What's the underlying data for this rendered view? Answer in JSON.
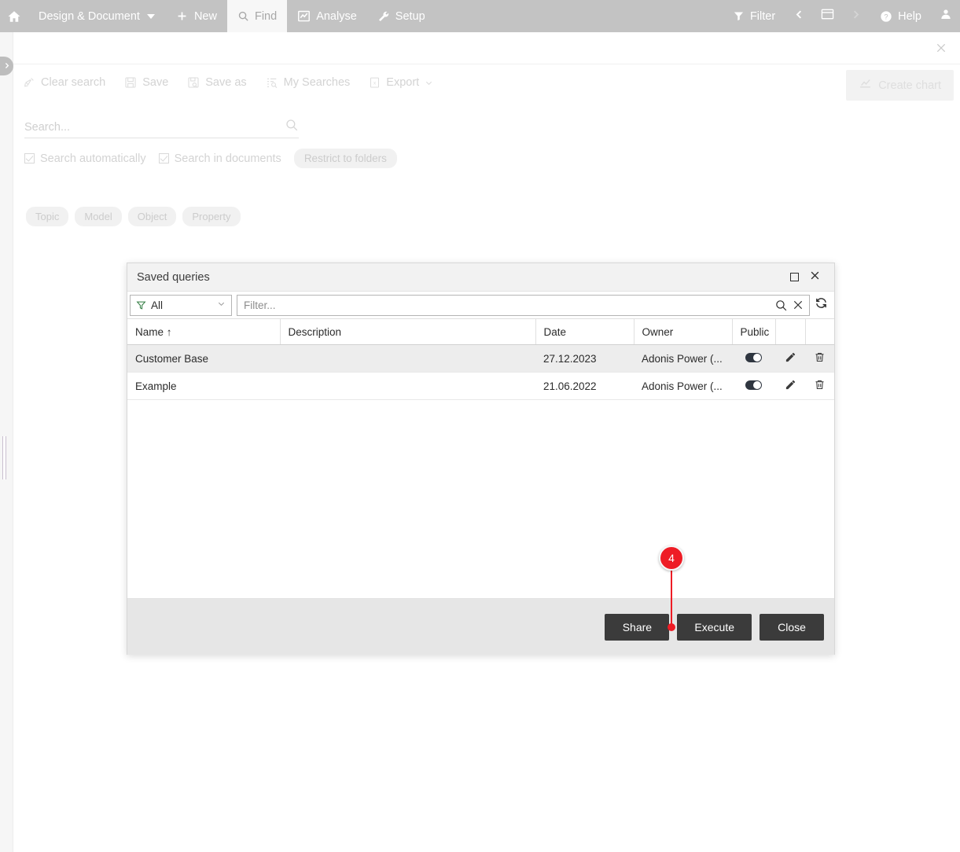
{
  "topbar": {
    "home_icon": "home-icon",
    "app_menu": {
      "label": "Design & Document",
      "icon": "chevron-down-icon"
    },
    "items": [
      {
        "label": "New",
        "icon": "plus-icon",
        "active": false
      },
      {
        "label": "Find",
        "icon": "search-icon",
        "active": true
      },
      {
        "label": "Analyse",
        "icon": "chart-line-icon",
        "active": false
      },
      {
        "label": "Setup",
        "icon": "wrench-icon",
        "active": false
      }
    ],
    "right": {
      "filter_label": "Filter",
      "filter_icon": "funnel-icon",
      "back_icon": "chevron-left-icon",
      "window_icon": "window-icon",
      "forward_icon": "chevron-right-icon",
      "help_label": "Help",
      "help_icon": "question-circle-icon",
      "user_icon": "user-icon"
    }
  },
  "page": {
    "close_icon": "close-icon",
    "rail_toggle_icon": "chevron-right-icon",
    "toolbar": [
      {
        "label": "Clear search",
        "icon": "broom-icon"
      },
      {
        "label": "Save",
        "icon": "floppy-disk-icon"
      },
      {
        "label": "Save as",
        "icon": "save-as-icon"
      },
      {
        "label": "My Searches",
        "icon": "list-search-icon"
      },
      {
        "label": "Export",
        "icon": "export-icon",
        "caret": "chevron-down-icon"
      }
    ],
    "create_chart": {
      "label": "Create chart",
      "icon": "chart-line-icon"
    },
    "search": {
      "placeholder": "Search...",
      "value": "",
      "icon": "search-icon"
    },
    "checkboxes": [
      {
        "label": "Search automatically",
        "checked": true
      },
      {
        "label": "Search in documents",
        "checked": true
      }
    ],
    "restrict_pill": "Restrict to folders",
    "scope_pills": [
      "Topic",
      "Model",
      "Object",
      "Property"
    ]
  },
  "dialog": {
    "title": "Saved queries",
    "maximize_icon": "maximize-icon",
    "close_icon": "close-icon",
    "type_select": {
      "value": "All",
      "icon": "funnel-icon",
      "caret": "chevron-down-icon"
    },
    "filter": {
      "placeholder": "Filter...",
      "value": "",
      "search_icon": "search-icon",
      "clear_icon": "close-icon"
    },
    "refresh_icon": "refresh-icon",
    "table": {
      "columns": [
        "Name",
        "Description",
        "Date",
        "Owner",
        "Public",
        "",
        ""
      ],
      "sort_column": "Name",
      "sort_indicator": "↑",
      "rows": [
        {
          "name": "Customer Base",
          "description": "",
          "date": "27.12.2023",
          "owner": "Adonis Power (...",
          "public": true,
          "edit_icon": "pencil-icon",
          "delete_icon": "trash-icon",
          "selected": true
        },
        {
          "name": "Example",
          "description": "",
          "date": "21.06.2022",
          "owner": "Adonis Power (...",
          "public": true,
          "edit_icon": "pencil-icon",
          "delete_icon": "trash-icon",
          "selected": false
        }
      ]
    },
    "buttons": [
      {
        "label": "Share"
      },
      {
        "label": "Execute"
      },
      {
        "label": "Close"
      }
    ]
  },
  "annotation": {
    "step_number": "4",
    "color": "#ee1c25",
    "points_to": "Share"
  }
}
